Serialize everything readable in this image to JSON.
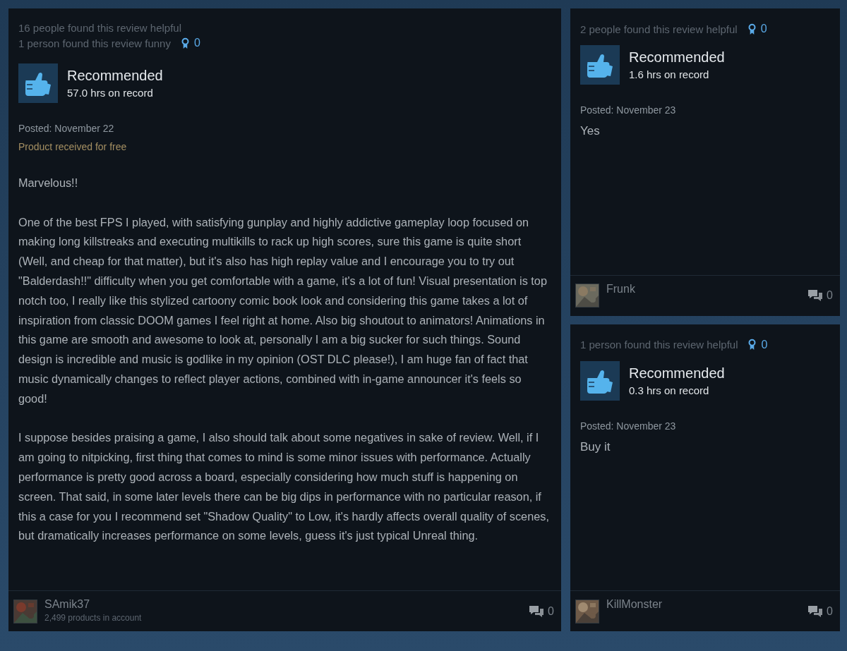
{
  "reviews": [
    {
      "helpful": "16 people found this review helpful",
      "funny": "1 person found this review funny",
      "awards": "0",
      "verdict": "Recommended",
      "hours": "57.0 hrs on record",
      "posted": "Posted: November 22",
      "free_note": "Product received for free",
      "paragraphs": [
        "Marvelous!!",
        "One of the best FPS I played, with satisfying gunplay and highly addictive gameplay loop focused on making long killstreaks and executing multikills to rack up high scores, sure this game is quite short (Well, and cheap for that matter), but it's also has high replay value and I encourage you to try out \"Balderdash!!\" difficulty when you get comfortable with a game, it's a lot of fun! Visual presentation is top notch too, I really like this stylized cartoony comic book look and considering this game takes a lot of inspiration from classic DOOM games I feel right at home. Also big shoutout to animators! Animations in this game are smooth and awesome to look at, personally I am a big sucker for such things. Sound design is incredible and music is godlike in my opinion (OST DLC please!), I am huge fan of fact that music dynamically changes to reflect player actions, combined with in-game announcer it's feels so good!",
        "I suppose besides praising a game, I also should talk about some negatives in sake of review. Well, if I am going to nitpicking, first thing that comes to mind is some minor issues with performance. Actually performance is pretty good across a board, especially considering how much stuff is happening on screen. That said, in some later levels there can be big dips in performance with no particular reason, if this a case for you I recommend set \"Shadow Quality\" to Low, it's hardly affects overall quality of scenes, but dramatically increases performance on some levels, guess it's just typical Unreal thing."
      ],
      "author": "SAmik37",
      "products": "2,499 products in account",
      "comments": "0"
    },
    {
      "helpful": "2 people found this review helpful",
      "awards": "0",
      "verdict": "Recommended",
      "hours": "1.6 hrs on record",
      "posted": "Posted: November 23",
      "paragraphs": [
        "Yes"
      ],
      "author": "Frunk",
      "comments": "0"
    },
    {
      "helpful": "1 person found this review helpful",
      "awards": "0",
      "verdict": "Recommended",
      "hours": "0.3 hrs on record",
      "posted": "Posted: November 23",
      "paragraphs": [
        "Buy it"
      ],
      "author": "KillMonster",
      "comments": "0"
    }
  ]
}
